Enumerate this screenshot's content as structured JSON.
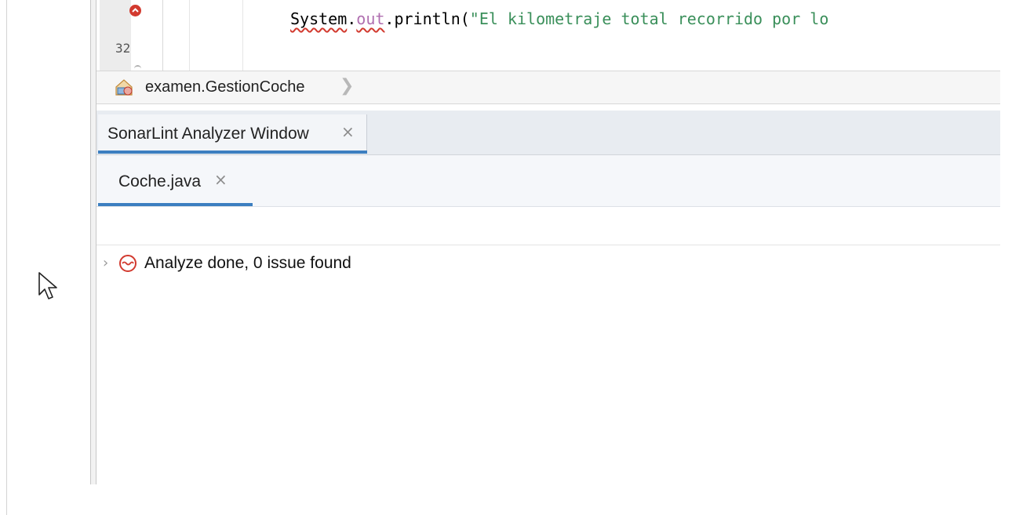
{
  "editor": {
    "line_number": "32",
    "code": {
      "object": "System",
      "dot1": ".",
      "field": "out",
      "method": ".println(",
      "string": "\"El kilometraje total recorrido por lo"
    }
  },
  "breadcrumb": {
    "label": "examen.GestionCoche",
    "icon": "class-icon"
  },
  "window_tab": {
    "label": "SonarLint Analyzer Window",
    "close": "×"
  },
  "file_tab": {
    "label": "Coche.java",
    "close": "×"
  },
  "results": {
    "chevron": "›",
    "status": "Analyze done, 0 issue found",
    "icon": "analysis-status-icon"
  },
  "colors": {
    "accent": "#3c7fc0",
    "error": "#d23a2f",
    "string": "#3a8f5a",
    "field": "#b06fb0"
  }
}
